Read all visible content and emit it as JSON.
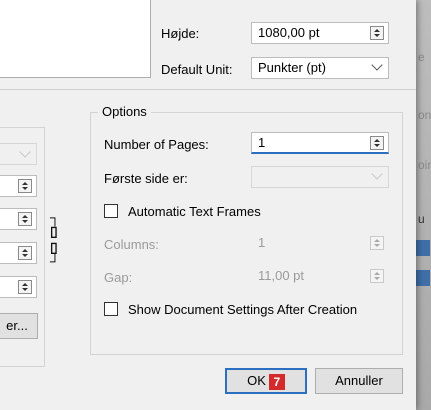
{
  "dialog": {
    "height_label": "Højde:",
    "height_value": "1080,00 pt",
    "default_unit_label": "Default Unit:",
    "default_unit_value": "Punkter (pt)",
    "left_button_label": "er...",
    "ok_label": "OK",
    "ok_badge": "7",
    "cancel_label": "Annuller"
  },
  "options": {
    "title": "Options",
    "number_of_pages_label": "Number of Pages:",
    "number_of_pages_value": "1",
    "first_page_label": "Første side er:",
    "first_page_value": "",
    "auto_text_frames_label": "Automatic Text Frames",
    "auto_text_frames_checked": false,
    "columns_label": "Columns:",
    "columns_value": "1",
    "gap_label": "Gap:",
    "gap_value": "11,00 pt",
    "show_settings_label": "Show Document Settings After Creation",
    "show_settings_checked": false
  },
  "background": {
    "ghost_texts": [
      "e",
      "on",
      "oin",
      "u"
    ]
  }
}
